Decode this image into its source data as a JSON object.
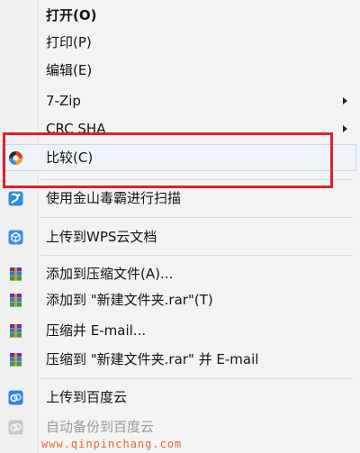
{
  "context_menu": {
    "items": [
      {
        "label": "打开(O)"
      },
      {
        "label": "打印(P)"
      },
      {
        "label": "编辑(E)"
      },
      {
        "label": "7-Zip"
      },
      {
        "label": "CRC SHA"
      },
      {
        "label": "比较(C)"
      },
      {
        "label": "使用金山毒霸进行扫描"
      },
      {
        "label": "上传到WPS云文档"
      },
      {
        "label": "添加到压缩文件(A)..."
      },
      {
        "label": "添加到 \"新建文件夹.rar\"(T)"
      },
      {
        "label": "压缩并 E-mail..."
      },
      {
        "label": "压缩到 \"新建文件夹.rar\" 并 E-mail"
      },
      {
        "label": "上传到百度云"
      },
      {
        "label": "自动备份到百度云"
      }
    ]
  },
  "colors": {
    "annotation": "#d7242c",
    "watermark": "#e66a2c"
  },
  "watermark": "www.qinpinchang.com"
}
